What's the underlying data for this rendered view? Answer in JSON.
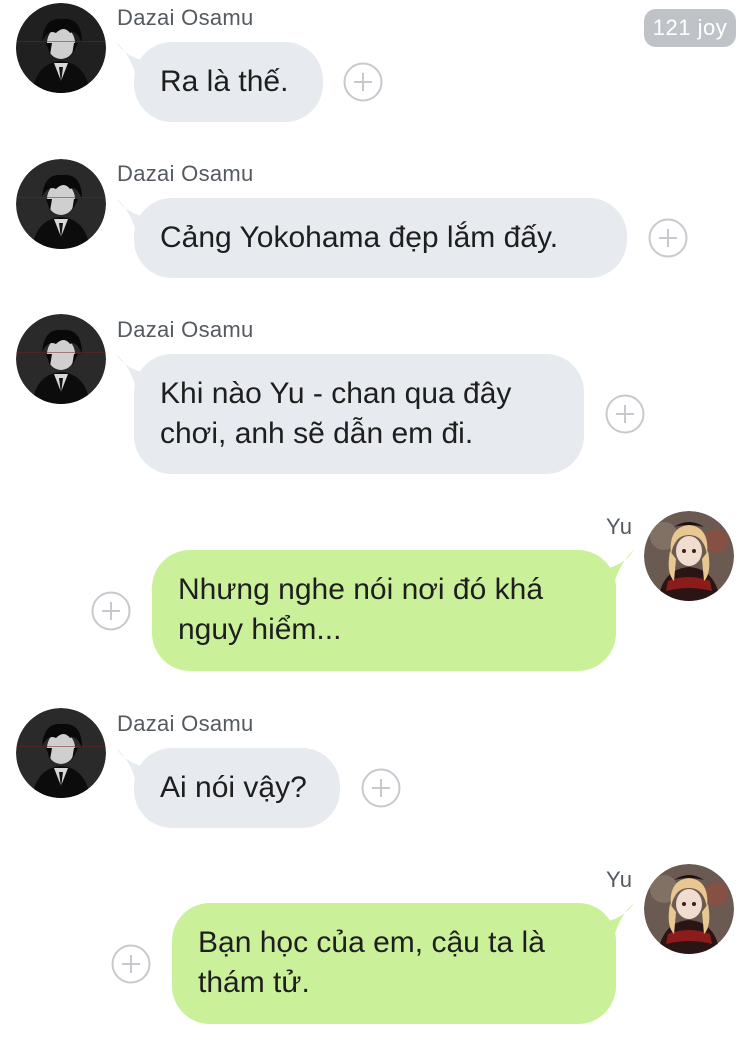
{
  "app": {
    "unread_badge": "121 joy"
  },
  "messages": [
    {
      "side": "left",
      "sender": "Dazai Osamu",
      "lines": [
        "Ra là thế."
      ]
    },
    {
      "side": "left",
      "sender": "Dazai Osamu",
      "lines": [
        "Cảng Yokohama đẹp lắm đấy."
      ]
    },
    {
      "side": "left",
      "sender": "Dazai Osamu",
      "lines": [
        "Khi nào Yu - chan qua đây",
        "chơi, anh sẽ dẫn em đi."
      ]
    },
    {
      "side": "right",
      "sender": "Yu",
      "lines": [
        "Nhưng nghe nói nơi đó khá",
        "nguy hiểm..."
      ]
    },
    {
      "side": "left",
      "sender": "Dazai Osamu",
      "lines": [
        "Ai nói vậy?"
      ]
    },
    {
      "side": "right",
      "sender": "Yu",
      "lines": [
        "Bạn học của em, cậu ta là",
        "thám tử."
      ]
    }
  ],
  "colors": {
    "left_bubble": "#e7ebef",
    "right_bubble": "#cbf09a",
    "sender_text": "#555a60",
    "plus_icon": "#c6cacf"
  },
  "icons": {
    "add_reaction": "plus-circle-icon",
    "avatar_dazai": "avatar-dazai",
    "avatar_yu": "avatar-yu"
  }
}
